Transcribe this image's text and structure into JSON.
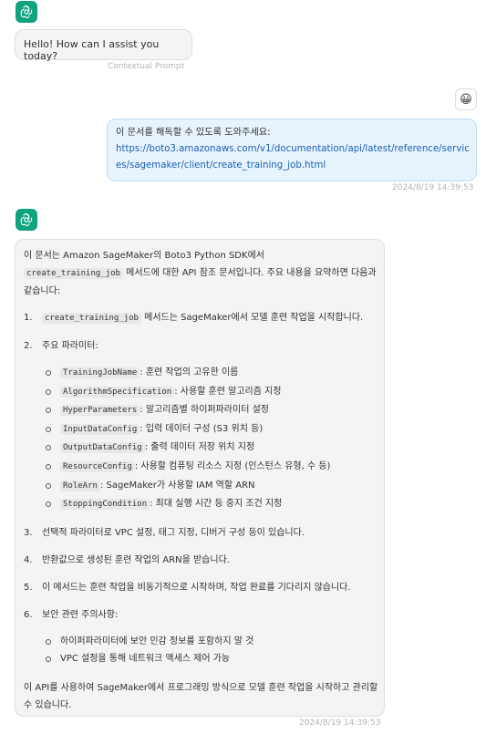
{
  "greeting": {
    "text": "Hello! How can I assist you today?",
    "label": "Contextual Prompt"
  },
  "user_message": {
    "emoji": "😀",
    "line1": "이 문서를 해독할 수 있도록 도와주세요:",
    "link": "https://boto3.amazonaws.com/v1/documentation/api/latest/reference/services/sagemaker/client/create_training_job.html",
    "timestamp": "2024/8/19 14:39:53"
  },
  "response": {
    "intro_a": "이 문서는 Amazon SageMaker의 Boto3 Python SDK에서",
    "intro_code": "create_training_job",
    "intro_b": " 메서드에 대한 API 참조 문서입니다. 주요 내용을 요약하면 다음과 같습니다:",
    "item1_num": "1.",
    "item1_code": "create_training_job",
    "item1_text": " 메서드는 SageMaker에서 모델 훈련 작업을 시작합니다.",
    "item2_num": "2.",
    "item2_text": "주요 파라미터:",
    "params": [
      {
        "code": "TrainingJobName",
        "desc": ": 훈련 작업의 고유한 이름"
      },
      {
        "code": "AlgorithmSpecification",
        "desc": ": 사용할 훈련 알고리즘 지정"
      },
      {
        "code": "HyperParameters",
        "desc": ": 알고리즘별 하이퍼파라미터 설정"
      },
      {
        "code": "InputDataConfig",
        "desc": ": 입력 데이터 구성 (S3 위치 등)"
      },
      {
        "code": "OutputDataConfig",
        "desc": ": 출력 데이터 저장 위치 지정"
      },
      {
        "code": "ResourceConfig",
        "desc": ": 사용할 컴퓨팅 리소스 지정 (인스턴스 유형, 수 등)"
      },
      {
        "code": "RoleArn",
        "desc": ": SageMaker가 사용할 IAM 역할 ARN"
      },
      {
        "code": "StoppingCondition",
        "desc": ": 최대 실행 시간 등 중지 조건 지정"
      }
    ],
    "item3_num": "3.",
    "item3_text": "선택적 파라미터로 VPC 설정, 태그 지정, 디버거 구성 등이 있습니다.",
    "item4_num": "4.",
    "item4_text": "반환값으로 생성된 훈련 작업의 ARN을 받습니다.",
    "item5_num": "5.",
    "item5_text": "이 메서드는 훈련 작업을 비동기적으로 시작하며, 작업 완료를 기다리지 않습니다.",
    "item6_num": "6.",
    "item6_text": "보안 관련 주의사항:",
    "security": [
      "하이퍼파라미터에 보안 민감 정보를 포함하지 말 것",
      "VPC 설정을 통해 네트워크 액세스 제어 가능"
    ],
    "conclusion": "이 API를 사용하여 SageMaker에서 프로그래밍 방식으로 모델 훈련 작업을 시작하고 관리할 수 있습니다.",
    "timestamp": "2024/8/19 14:39:53"
  },
  "colors": {
    "bot_avatar": "#10a37f",
    "link": "#1a5fb4",
    "user_bubble": "#e8f4fd",
    "bot_bubble": "#f4f4f5"
  },
  "icons": {
    "bot_avatar": "openai-logo-icon",
    "user_avatar": "smiley-emoji-icon"
  }
}
